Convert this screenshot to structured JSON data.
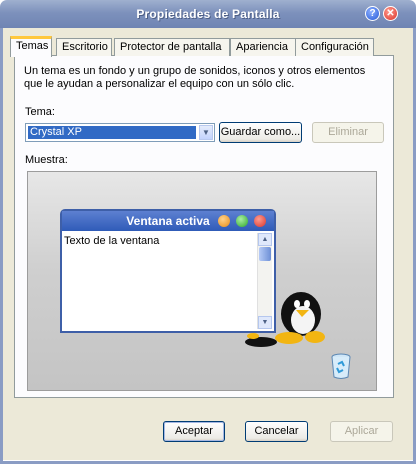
{
  "window": {
    "title": "Propiedades de Pantalla",
    "help_glyph": "?",
    "close_glyph": "✕"
  },
  "tabs": [
    {
      "label": "Temas",
      "active": true
    },
    {
      "label": "Escritorio"
    },
    {
      "label": "Protector de pantalla"
    },
    {
      "label": "Apariencia"
    },
    {
      "label": "Configuración"
    }
  ],
  "themes": {
    "description_line1": "Un tema es un fondo y un grupo de sonidos, iconos y otros elementos",
    "description_line2": "que le ayudan a personalizar el equipo con un sólo clic.",
    "theme_label": "Tema:",
    "theme_value": "Crystal XP",
    "save_label": "Guardar como...",
    "delete_label": "Eliminar",
    "sample_label": "Muestra:"
  },
  "preview": {
    "window_title": "Ventana activa",
    "window_text": "Texto de la ventana"
  },
  "footer": {
    "ok_label": "Aceptar",
    "cancel_label": "Cancelar",
    "apply_label": "Aplicar"
  },
  "colors": {
    "selection": "#316ac5",
    "title_bar": "#7d91bc",
    "active_tab_accent": "#ffc83c"
  }
}
